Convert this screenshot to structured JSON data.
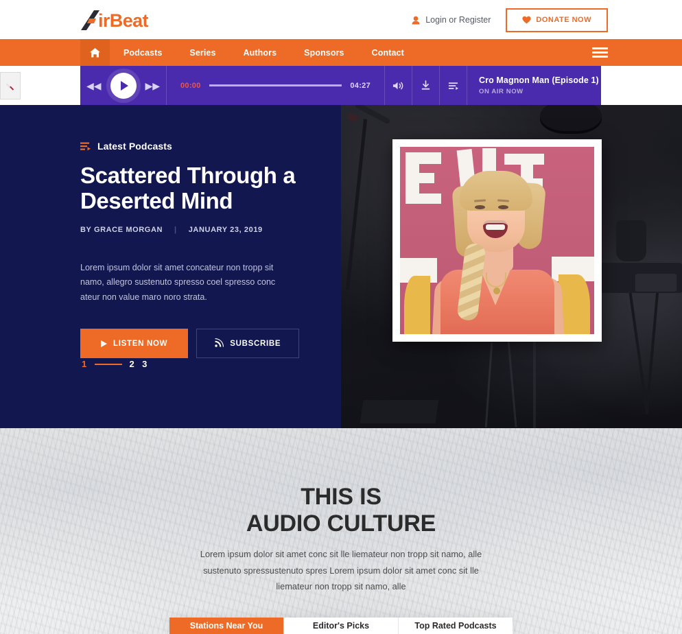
{
  "brand": {
    "logo_mark": "a-logo-icon",
    "logo_text": "irBeat",
    "accent_orange": "#ED6B26",
    "player_purple": "#4A2BAE",
    "hero_navy": "#131750"
  },
  "topbar": {
    "login_label": "Login or Register",
    "login_icon": "user-icon",
    "donate_label": "DONATE NOW",
    "donate_icon": "heart-icon"
  },
  "nav": {
    "home_icon": "home-icon",
    "items": [
      {
        "label": "Podcasts"
      },
      {
        "label": "Series"
      },
      {
        "label": "Authors"
      },
      {
        "label": "Sponsors"
      },
      {
        "label": "Contact"
      }
    ],
    "menu_icon": "hamburger-icon"
  },
  "player": {
    "rewind_icon": "rewind-icon",
    "play_icon": "play-icon",
    "forward_icon": "forward-icon",
    "current_time": "00:00",
    "total_time": "04:27",
    "progress_percent": 0,
    "volume_icon": "volume-icon",
    "download_icon": "download-icon",
    "playlist_icon": "playlist-icon",
    "track_title": "Cro Magnon Man (Episode 1)",
    "track_status": "ON AIR NOW"
  },
  "side_tab": {
    "icon": "bookmark-icon"
  },
  "hero": {
    "eyebrow_icon": "playlist-arrow-icon",
    "eyebrow": "Latest Podcasts",
    "title_line1": "Scattered Through a",
    "title_line2": "Deserted Mind",
    "author": "BY GRACE MORGAN",
    "date": "JANUARY 23, 2019",
    "description": "Lorem ipsum dolor sit amet concateur non tropp sit namo, allegro sustenuto spresso coel spresso conc ateur non value maro noro strata.",
    "listen_label": "LISTEN NOW",
    "listen_icon": "play-icon",
    "subscribe_label": "SUBSCRIBE",
    "subscribe_icon": "rss-icon",
    "pagination": [
      {
        "label": "1",
        "active": true
      },
      {
        "label": "2",
        "active": false
      },
      {
        "label": "3",
        "active": false
      }
    ],
    "photo_alt": "laughing-blonde-woman-photo"
  },
  "culture": {
    "heading_line1": "THIS IS",
    "heading_line2": "AUDIO CULTURE",
    "desc_line1": "Lorem ipsum dolor sit amet conc sit lle liemateur non tropp sit namo, alle",
    "desc_line2": "sustenuto spressustenuto spres Lorem ipsum dolor sit amet conc sit lle",
    "desc_line3": "liemateur non tropp sit namo, alle"
  },
  "tabs": [
    {
      "label": "Stations Near You",
      "active": true
    },
    {
      "label": "Editor's Picks",
      "active": false
    },
    {
      "label": "Top Rated Podcasts",
      "active": false
    }
  ]
}
